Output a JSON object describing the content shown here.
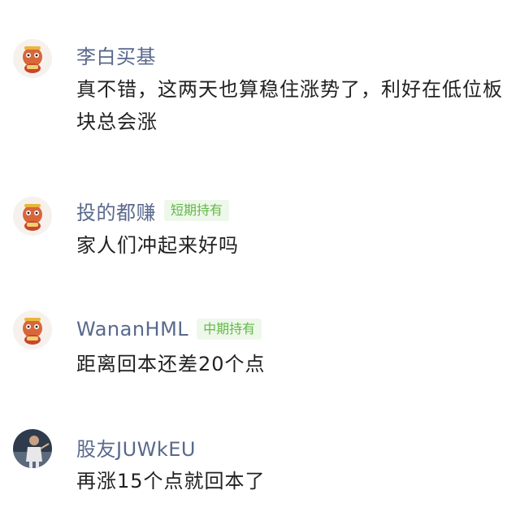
{
  "comments": [
    {
      "username": "李白买基",
      "badge": "",
      "avatar": "lion-dance-mascot-avatar",
      "text": "真不错，这两天也算稳住涨势了，利好在低位板块总会涨"
    },
    {
      "username": "投的都赚",
      "badge": "短期持有",
      "avatar": "lion-dance-mascot-avatar",
      "text": "家人们冲起来好吗"
    },
    {
      "username": "WananHML",
      "badge": "中期持有",
      "avatar": "lion-dance-mascot-avatar",
      "text": "距离回本还差20个点"
    },
    {
      "username": "股友JUWkEU",
      "badge": "",
      "avatar": "sports-player-photo-avatar",
      "text": "再涨15个点就回本了"
    }
  ],
  "colors": {
    "username": "#59698c",
    "badge_text": "#62b94a",
    "badge_bg": "#eef8ea",
    "body_text": "#222222"
  }
}
